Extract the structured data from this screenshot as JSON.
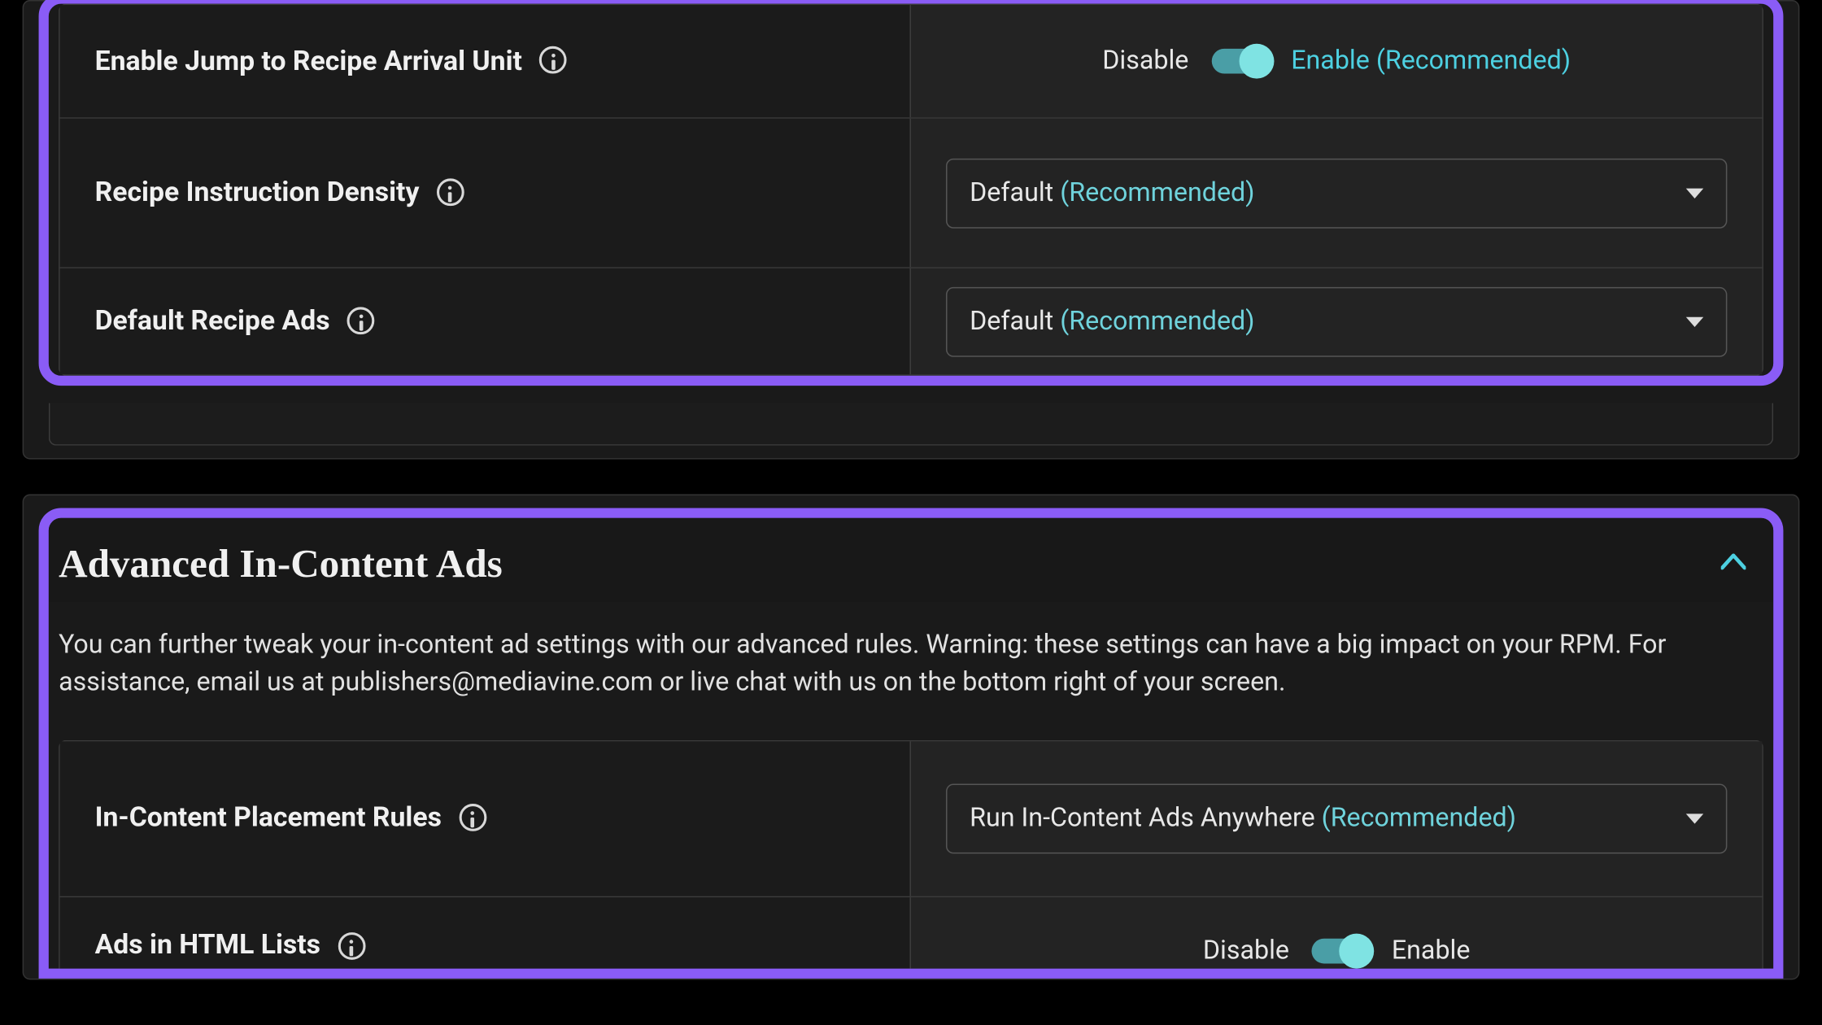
{
  "top_section": {
    "rows": [
      {
        "label": "Enable Jump to Recipe Arrival Unit",
        "toggle": {
          "off": "Disable",
          "on": "Enable (Recommended)"
        }
      },
      {
        "label": "Recipe Instruction Density",
        "select": {
          "value": "Default",
          "rec": " (Recommended)"
        }
      },
      {
        "label": "Default Recipe Ads",
        "select": {
          "value": "Default",
          "rec": " (Recommended)"
        }
      }
    ]
  },
  "advanced": {
    "title": "Advanced In-Content Ads",
    "desc": "You can further tweak your in-content ad settings with our advanced rules. Warning: these settings can have a big impact on your RPM. For assistance, email us at publishers@mediavine.com or live chat with us on the bottom right of your screen.",
    "rows": [
      {
        "label": "In-Content Placement Rules",
        "select": {
          "value": "Run In-Content Ads Anywhere",
          "rec": " (Recommended)"
        }
      },
      {
        "label": "Ads in HTML Lists",
        "toggle": {
          "off": "Disable",
          "on": "Enable"
        }
      }
    ]
  }
}
